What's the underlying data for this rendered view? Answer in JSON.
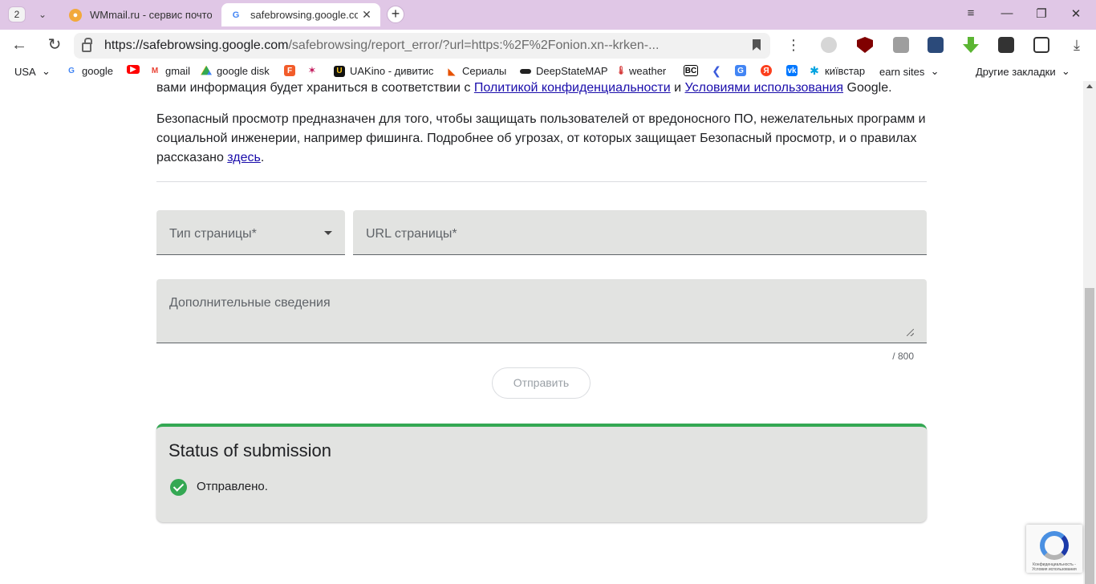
{
  "browser": {
    "tab_count": "2",
    "tabs": [
      {
        "title": "WMmail.ru - сервис почтовых рассылок",
        "active": false
      },
      {
        "title": "safebrowsing.google.com",
        "active": true
      }
    ],
    "address": {
      "host": "https://safebrowsing.google.com",
      "path": "/safebrowsing/report_error/?url=https:%2F%2Fonion.xn--krken-..."
    },
    "bookmarks": [
      {
        "label": "USA",
        "icon": "dropdown-folder"
      },
      {
        "label": "google",
        "icon": "google-icon"
      },
      {
        "label": "",
        "icon": "youtube-icon"
      },
      {
        "label": "gmail",
        "icon": "gmail-icon"
      },
      {
        "label": "google disk",
        "icon": "drive-icon"
      },
      {
        "label": "",
        "icon": "f-icon"
      },
      {
        "label": "",
        "icon": "star-icon"
      },
      {
        "label": "UAKino - дивитис",
        "icon": "uakino-icon"
      },
      {
        "label": "Сериалы",
        "icon": "fox-icon"
      },
      {
        "label": "DeepStateMAP",
        "icon": "deepstate-icon"
      },
      {
        "label": "weather",
        "icon": "thermometer-icon"
      },
      {
        "label": "",
        "icon": "bc-icon"
      },
      {
        "label": "",
        "icon": "chevron-icon"
      },
      {
        "label": "",
        "icon": "translate-icon"
      },
      {
        "label": "",
        "icon": "yandex-icon"
      },
      {
        "label": "",
        "icon": "vk-icon"
      },
      {
        "label": "київстар",
        "icon": "kyivstar-icon"
      },
      {
        "label": "earn sites",
        "icon": "dropdown-folder"
      },
      {
        "label": "Другие закладки",
        "icon": "dropdown-folder"
      }
    ]
  },
  "page": {
    "para1": {
      "lead": "вами информация будет храниться в соответствии с ",
      "privacy_link": "Политикой конфиденциальности",
      "and": " и ",
      "terms_link": "Условиями использования",
      "tail": " Google."
    },
    "para2": {
      "text": "Безопасный просмотр предназначен для того, чтобы защищать пользователей от вредоносного ПО, нежелательных программ и социальной инженерии, например фишинга. Подробнее об угрозах, от которых защищает Безопасный просмотр, и о правилах рассказано ",
      "here_link": "здесь",
      "end": "."
    },
    "form": {
      "page_type_label": "Тип страницы*",
      "url_label": "URL страницы*",
      "details_label": "Дополнительные сведения",
      "counter": "/ 800",
      "submit_label": "Отправить"
    },
    "status": {
      "title": "Status of submission",
      "message": "Отправлено."
    },
    "recaptcha": {
      "text": "Конфиденциальность - Условия использования"
    }
  },
  "colors": {
    "tabstrip": "#e0c7e6",
    "field_bg": "#e2e3e1",
    "success": "#34a853",
    "link": "#1a0dab"
  }
}
